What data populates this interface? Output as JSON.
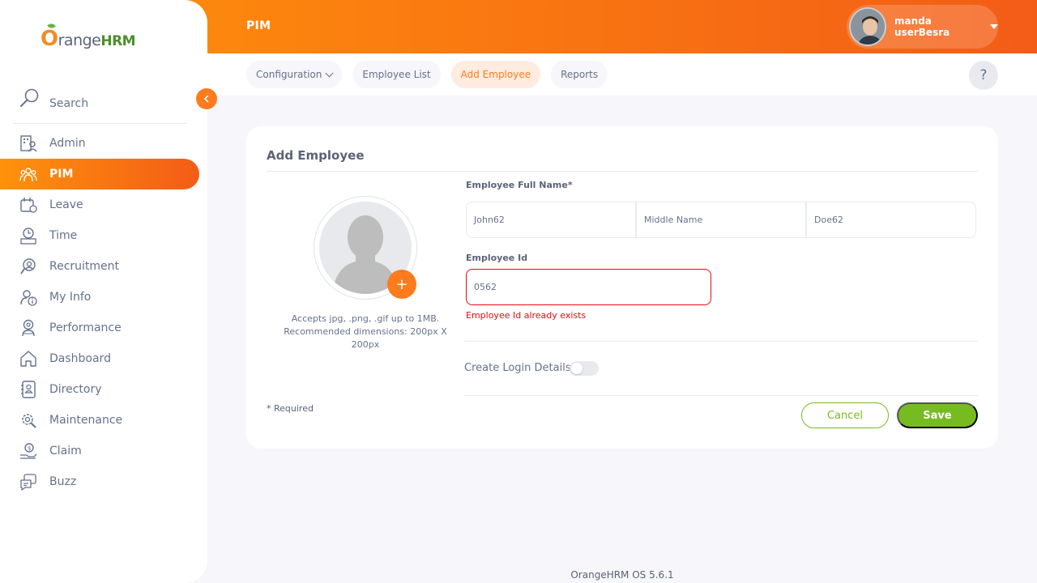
{
  "brand": {
    "logo_o": "O",
    "logo_range": "range",
    "logo_hrm": "HRM"
  },
  "header": {
    "module_title": "PIM",
    "user_name": "manda userBesra"
  },
  "sidebar": {
    "search_label": "Search",
    "items": [
      {
        "label": "Admin",
        "icon": "admin-icon"
      },
      {
        "label": "PIM",
        "icon": "pim-icon",
        "active": true
      },
      {
        "label": "Leave",
        "icon": "leave-icon"
      },
      {
        "label": "Time",
        "icon": "time-icon"
      },
      {
        "label": "Recruitment",
        "icon": "recruitment-icon"
      },
      {
        "label": "My Info",
        "icon": "my-info-icon"
      },
      {
        "label": "Performance",
        "icon": "performance-icon"
      },
      {
        "label": "Dashboard",
        "icon": "dashboard-icon"
      },
      {
        "label": "Directory",
        "icon": "directory-icon"
      },
      {
        "label": "Maintenance",
        "icon": "maintenance-icon"
      },
      {
        "label": "Claim",
        "icon": "claim-icon"
      },
      {
        "label": "Buzz",
        "icon": "buzz-icon"
      }
    ]
  },
  "tabs": [
    {
      "label": "Configuration"
    },
    {
      "label": "Employee List"
    },
    {
      "label": "Add Employee",
      "active": true
    },
    {
      "label": "Reports"
    }
  ],
  "help_label": "?",
  "form": {
    "title": "Add Employee",
    "photo_hint": "Accepts jpg, .png, .gif up to 1MB. Recommended dimensions: 200px X 200px",
    "photo_add": "+",
    "full_name_label": "Employee Full Name*",
    "first_name_value": "John62",
    "middle_name_placeholder": "Middle Name",
    "last_name_value": "Doe62",
    "employee_id_label": "Employee Id",
    "employee_id_value": "0562",
    "employee_id_error": "Employee Id already exists",
    "create_login_label": "Create Login Details",
    "create_login_enabled": false,
    "required_note": "* Required",
    "cancel_label": "Cancel",
    "save_label": "Save"
  },
  "footer": {
    "version": "OrangeHRM OS 5.6.1"
  },
  "colors": {
    "accent": "#ff7b1d",
    "accent_gradient_start": "#ff920b",
    "accent_gradient_end": "#f35c17",
    "save_green": "#76bc21",
    "error_red": "#eb0910",
    "text": "#64728c"
  }
}
